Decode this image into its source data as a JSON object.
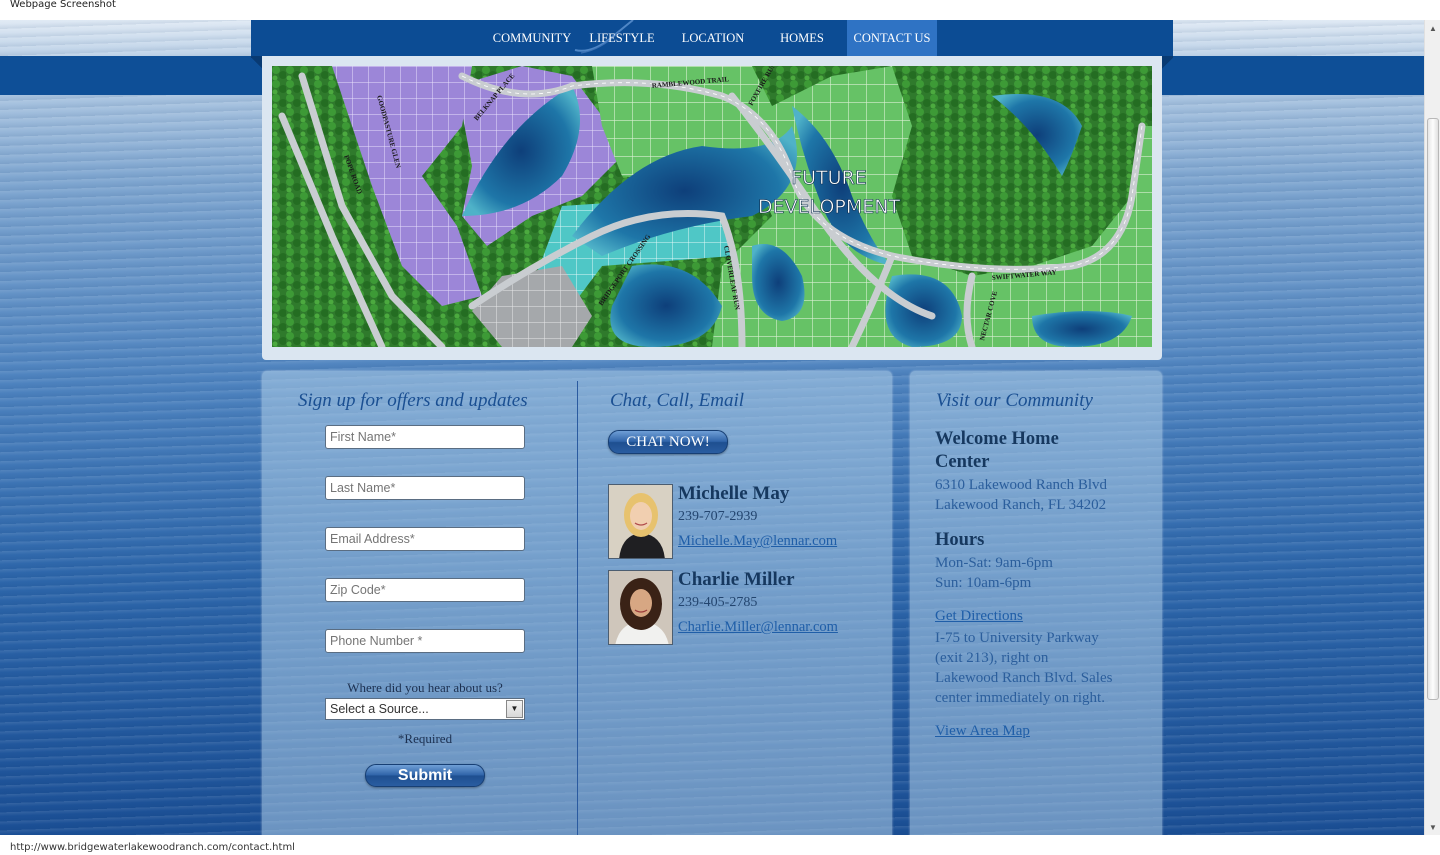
{
  "caption": "Webpage Screenshot",
  "nav": {
    "items": [
      {
        "label": "COMMUNITY"
      },
      {
        "label": "LIFESTYLE"
      },
      {
        "label": "LOCATION"
      },
      {
        "label": "HOMES"
      },
      {
        "label": "CONTACT US"
      }
    ],
    "active": "CONTACT US"
  },
  "banner": {
    "overlay_line1": "FUTURE",
    "overlay_line2": "DEVELOPMENT",
    "streets": [
      "RAMBLEWOOD TRAIL",
      "FOXFIRE RUN",
      "GOODPASTURE GLEN",
      "BELKNAP PLACE",
      "POPE ROAD",
      "BRIDGEPORT CROSSING",
      "CLOVERLEAF RUN",
      "SWIFTWATER WAY",
      "NECTAR COVE"
    ]
  },
  "signup": {
    "heading": "Sign up for offers and updates",
    "fields": [
      {
        "placeholder": "First Name*"
      },
      {
        "placeholder": "Last Name*"
      },
      {
        "placeholder": "Email Address*"
      },
      {
        "placeholder": "Zip Code*"
      },
      {
        "placeholder": "Phone Number *"
      }
    ],
    "source_label": "Where did you hear about us?",
    "source_value": "Select a Source...",
    "required_note": "*Required",
    "submit_label": "Submit"
  },
  "contact": {
    "heading": "Chat, Call, Email",
    "chat_label": "CHAT NOW!",
    "agents": [
      {
        "name": "Michelle May",
        "phone": "239-707-2939",
        "email": "Michelle.May@lennar.com"
      },
      {
        "name": "Charlie Miller",
        "phone": "239-405-2785",
        "email": "Charlie.Miller@lennar.com"
      }
    ]
  },
  "visit": {
    "heading": "Visit our Community",
    "center_title_1": "Welcome Home",
    "center_title_2": "Center",
    "address_1": "6310 Lakewood Ranch Blvd",
    "address_2": "Lakewood Ranch, FL 34202",
    "hours_title": "Hours",
    "hours_1": "Mon-Sat: 9am-6pm",
    "hours_2": "Sun: 10am-6pm",
    "directions_link": "Get Directions",
    "directions_1": "I-75 to University Parkway",
    "directions_2": "(exit 213), right on",
    "directions_3": "Lakewood Ranch Blvd. Sales",
    "directions_4": "center immediately on right.",
    "map_link": "View Area Map"
  },
  "status_url": "http://www.bridgewaterlakewoodranch.com/contact.html",
  "colors": {
    "nav": "#0c4c94",
    "nav_active": "#2f73c4",
    "accent_text": "#1a4f92",
    "link": "#1f5ea8"
  }
}
